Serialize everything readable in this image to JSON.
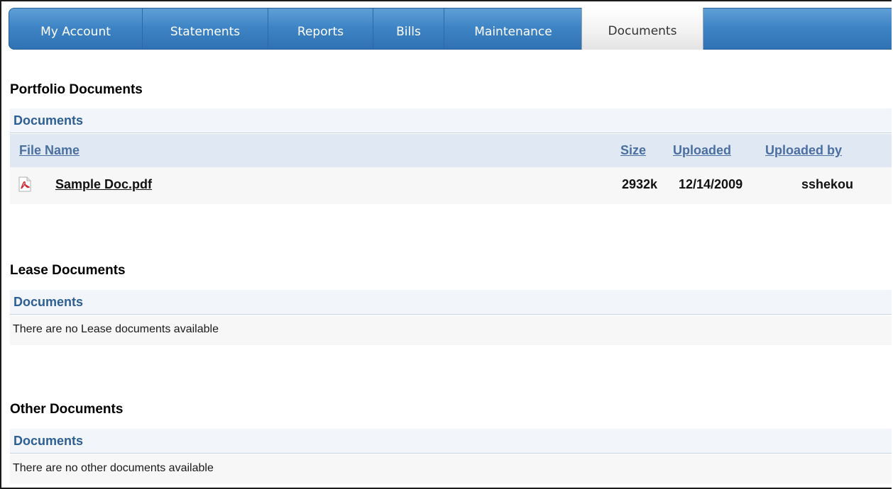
{
  "tabs": [
    {
      "label": "My Account",
      "active": false
    },
    {
      "label": "Statements",
      "active": false
    },
    {
      "label": "Reports",
      "active": false
    },
    {
      "label": "Bills",
      "active": false
    },
    {
      "label": "Maintenance",
      "active": false
    },
    {
      "label": "Documents",
      "active": true
    }
  ],
  "portfolio": {
    "title": "Portfolio Documents",
    "header": "Documents",
    "columns": {
      "file_name": "File Name",
      "size": "Size",
      "uploaded": "Uploaded",
      "uploaded_by": "Uploaded by"
    },
    "rows": [
      {
        "icon": "pdf-icon",
        "file_name": "Sample Doc.pdf",
        "size": "2932k",
        "uploaded": "12/14/2009",
        "uploaded_by": "sshekou"
      }
    ]
  },
  "lease": {
    "title": "Lease Documents",
    "header": "Documents",
    "empty_message": "There are no Lease documents available"
  },
  "other": {
    "title": "Other Documents",
    "header": "Documents",
    "empty_message": "There are no other documents available"
  },
  "colors": {
    "tab_blue": "#3f85c6",
    "header_text": "#2e5f94",
    "link_blue": "#4a6fa0"
  }
}
